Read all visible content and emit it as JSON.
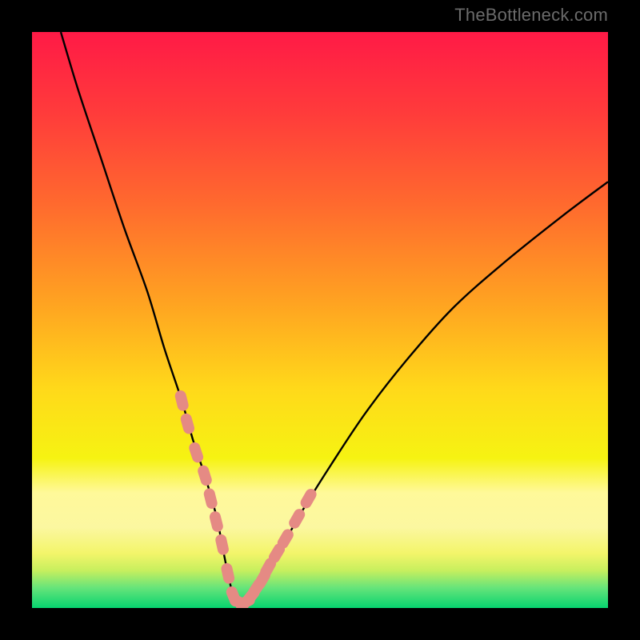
{
  "watermark": "TheBottleneck.com",
  "colors": {
    "frame": "#000000",
    "gradient_stops": [
      {
        "offset": 0.0,
        "color": "#ff1a46"
      },
      {
        "offset": 0.14,
        "color": "#ff3b3b"
      },
      {
        "offset": 0.3,
        "color": "#ff6a2e"
      },
      {
        "offset": 0.47,
        "color": "#ffa321"
      },
      {
        "offset": 0.62,
        "color": "#ffd91a"
      },
      {
        "offset": 0.74,
        "color": "#f6f312"
      },
      {
        "offset": 0.8,
        "color": "#fff99a"
      },
      {
        "offset": 0.86,
        "color": "#fbf7a0"
      },
      {
        "offset": 0.905,
        "color": "#f3f56a"
      },
      {
        "offset": 0.935,
        "color": "#c7ef5e"
      },
      {
        "offset": 0.965,
        "color": "#66e47a"
      },
      {
        "offset": 1.0,
        "color": "#06d46f"
      }
    ],
    "curve": "#000000",
    "marker_fill": "#e58a84",
    "marker_stroke": "#c96e69"
  },
  "chart_data": {
    "type": "line",
    "title": "",
    "xlabel": "",
    "ylabel": "",
    "xlim": [
      0,
      100
    ],
    "ylim": [
      0,
      100
    ],
    "series": [
      {
        "name": "bottleneck-curve",
        "x": [
          5,
          8,
          12,
          16,
          20,
          23,
          26,
          28,
          30,
          32,
          33,
          34,
          35,
          36,
          37,
          38,
          40,
          43,
          47,
          52,
          58,
          65,
          73,
          82,
          92,
          100
        ],
        "y": [
          100,
          90,
          78,
          66,
          55,
          45,
          36,
          29,
          23,
          16,
          11,
          6,
          2,
          1,
          1,
          2,
          5,
          10,
          17,
          25,
          34,
          43,
          52,
          60,
          68,
          74
        ]
      }
    ],
    "markers": {
      "name": "highlighted-points",
      "x": [
        26,
        27,
        28.5,
        30,
        31,
        32,
        33,
        34,
        35,
        36,
        37,
        38,
        39,
        40,
        41,
        42.5,
        44,
        46,
        48
      ],
      "y": [
        36,
        32,
        27,
        23,
        19,
        15,
        11,
        6,
        2,
        1,
        1,
        2,
        3.5,
        5,
        7,
        9.5,
        12,
        15.5,
        19
      ]
    }
  }
}
